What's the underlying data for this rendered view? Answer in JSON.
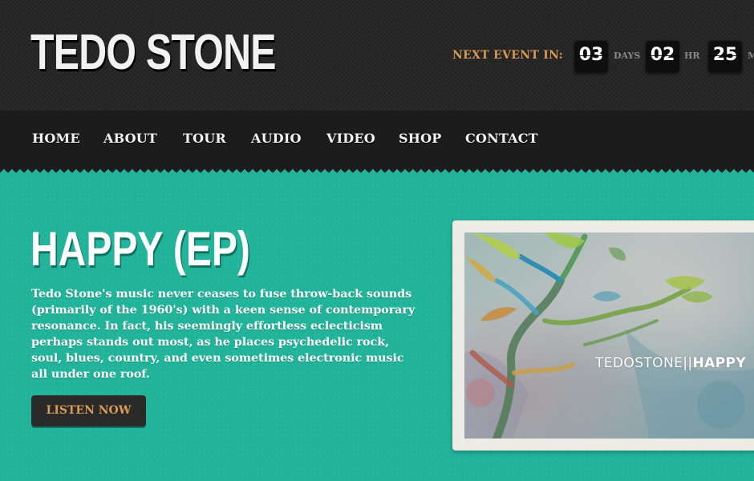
{
  "site": {
    "logo": "TEDO STONE"
  },
  "countdown": {
    "label": "NEXT EVENT IN:",
    "days_value": "03",
    "days_unit": "DAYS",
    "hours_value": "02",
    "hours_unit": "HR",
    "minutes_value": "25",
    "minutes_unit": "M"
  },
  "nav": {
    "items": [
      {
        "label": "HOME"
      },
      {
        "label": "ABOUT"
      },
      {
        "label": "TOUR"
      },
      {
        "label": "AUDIO"
      },
      {
        "label": "VIDEO"
      },
      {
        "label": "SHOP"
      },
      {
        "label": "CONTACT"
      }
    ]
  },
  "feature": {
    "title": "HAPPY (EP)",
    "description": "Tedo Stone's music never ceases to fuse throw-back sounds (primarily of the 1960's) with a keen sense of contemporary resonance. In fact, his seemingly effortless eclecticism perhaps stands out most, as he places psychedelic rock, soul, blues, country, and even sometimes electronic music all under one roof.",
    "button_label": "LISTEN NOW",
    "album_caption_artist": "TEDOSTONE",
    "album_caption_separator": "||",
    "album_caption_title": "HAPPY"
  },
  "colors": {
    "header_bg": "#262626",
    "nav_bg": "#1c1c1c",
    "content_bg": "#22b49b",
    "accent_orange": "#d89a55",
    "text_white": "#ffffff"
  }
}
